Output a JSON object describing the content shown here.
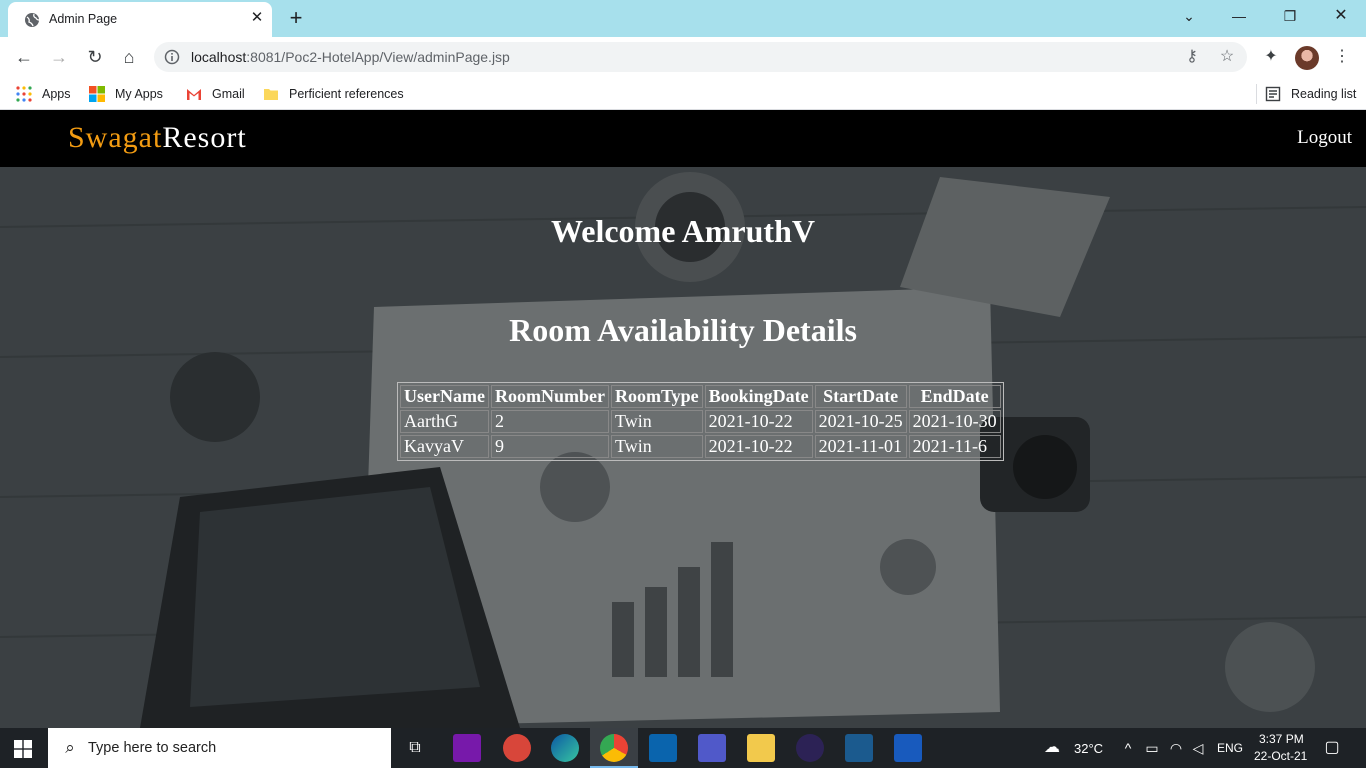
{
  "browser": {
    "tab_title": "Admin Page",
    "tab_close": "✕",
    "new_tab": "+",
    "url_host": "localhost",
    "url_rest": ":8081/Poc2-HotelApp/View/adminPage.jsp",
    "bookmarks": [
      {
        "label": "Apps"
      },
      {
        "label": "My Apps"
      },
      {
        "label": "Gmail"
      },
      {
        "label": "Perficient references"
      }
    ],
    "reading_list": "Reading list"
  },
  "navbar": {
    "brand_part1": "Swagat",
    "brand_part2": "Resort",
    "brand_color1": "#f39c12",
    "logout": "Logout"
  },
  "main": {
    "welcome": "Welcome AmruthV",
    "subtitle": "Room Availability Details",
    "table": {
      "headers": [
        "UserName",
        "RoomNumber",
        "RoomType",
        "BookingDate",
        "StartDate",
        "EndDate"
      ],
      "rows": [
        [
          "AarthG",
          "2",
          "Twin",
          "2021-10-22",
          "2021-10-25",
          "2021-10-30"
        ],
        [
          "KavyaV",
          "9",
          "Twin",
          "2021-10-22",
          "2021-11-01",
          "2021-11-6"
        ]
      ]
    }
  },
  "taskbar": {
    "search_placeholder": "Type here to search",
    "weather": "32°C",
    "language": "ENG",
    "time": "3:37 PM",
    "date": "22-Oct-21"
  }
}
